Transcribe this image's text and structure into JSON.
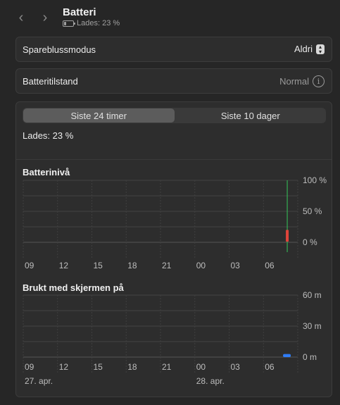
{
  "header": {
    "back_icon": "chevron-left",
    "forward_icon": "chevron-right",
    "title": "Batteri",
    "subtitle": "Lades: 23 %"
  },
  "low_power": {
    "label": "Spareblussmodus",
    "value": "Aldri"
  },
  "battery_health": {
    "label": "Batteritilstand",
    "value": "Normal"
  },
  "tabs": {
    "items": [
      "Siste 24 timer",
      "Siste 10 dager"
    ],
    "selected": 0
  },
  "charge_status": "Lades: 23 %",
  "colors": {
    "accent_red": "#e0443a",
    "accent_green": "#34c759",
    "accent_blue": "#2f7cf6"
  },
  "charts": {
    "battery_level": {
      "title": "Batterinivå",
      "y_ticks": [
        "100 %",
        "50 %",
        "0 %"
      ],
      "x_ticks": [
        "09",
        "12",
        "15",
        "18",
        "21",
        "00",
        "03",
        "06"
      ]
    },
    "screen_on": {
      "title": "Brukt med skjermen på",
      "y_ticks": [
        "60 m",
        "30 m",
        "0 m"
      ],
      "x_ticks": [
        "09",
        "12",
        "15",
        "18",
        "21",
        "00",
        "03",
        "06"
      ],
      "date_labels": [
        "27. apr.",
        "28. apr."
      ]
    }
  },
  "chart_data": [
    {
      "type": "bar",
      "title": "Batterinivå",
      "ylim": [
        0,
        100
      ],
      "x_ticks": [
        "09",
        "12",
        "15",
        "18",
        "21",
        "00",
        "03",
        "06"
      ],
      "bars": [
        {
          "x": "07",
          "low": 1,
          "high": 20
        }
      ],
      "charging_marker": {
        "x": "07",
        "range": [
          0,
          100
        ]
      }
    },
    {
      "type": "bar",
      "title": "Brukt med skjermen på",
      "ylim": [
        0,
        60
      ],
      "x_ticks": [
        "09",
        "12",
        "15",
        "18",
        "21",
        "00",
        "03",
        "06"
      ],
      "bars": [
        {
          "x": "07",
          "value": 3
        }
      ]
    }
  ]
}
